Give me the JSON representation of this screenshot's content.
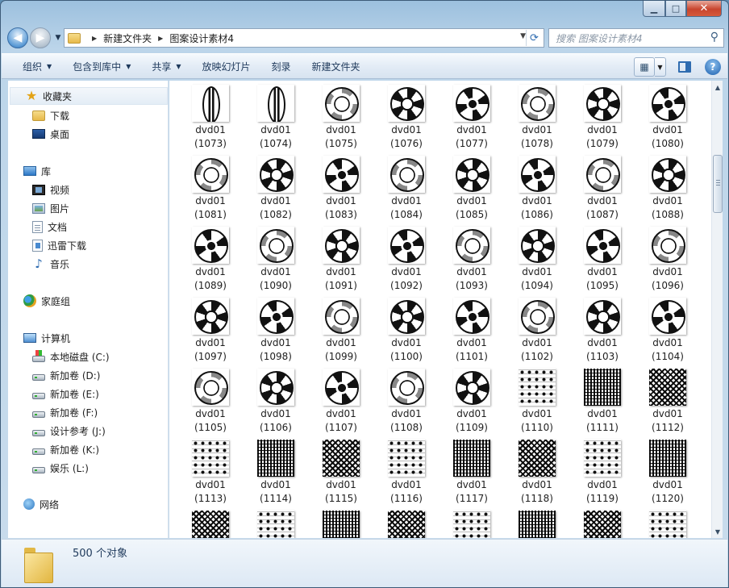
{
  "window": {
    "buttons": {
      "minimize": "▁",
      "maximize": "□",
      "close": "✕"
    }
  },
  "nav": {
    "back_icon": "arrow-left-icon",
    "forward_icon": "arrow-right-icon",
    "address": {
      "crumbs": [
        "新建文件夹",
        "图案设计素材4"
      ]
    },
    "search": {
      "placeholder": "搜索 图案设计素材4"
    }
  },
  "toolbar": {
    "organize": "组织",
    "include_in_library": "包含到库中",
    "share": "共享",
    "slideshow": "放映幻灯片",
    "burn": "刻录",
    "new_folder": "新建文件夹"
  },
  "sidebar": {
    "favorites": "收藏夹",
    "downloads": "下载",
    "desktop": "桌面",
    "libraries": "库",
    "videos": "视频",
    "pictures": "图片",
    "documents": "文档",
    "thunder": "迅雷下载",
    "music": "音乐",
    "homegroup": "家庭组",
    "computer": "计算机",
    "drive_c": "本地磁盘 (C:)",
    "drive_d": "新加卷 (D:)",
    "drive_e": "新加卷 (E:)",
    "drive_f": "新加卷 (F:)",
    "drive_j": "设计参考 (J:)",
    "drive_k": "新加卷 (K:)",
    "drive_l": "娱乐 (L:)",
    "network": "网络"
  },
  "files": {
    "prefix": "dvd01",
    "start_number": 1073,
    "labeled_count": 48,
    "partial_row_count": 8
  },
  "status": {
    "count": "500 个对象"
  }
}
